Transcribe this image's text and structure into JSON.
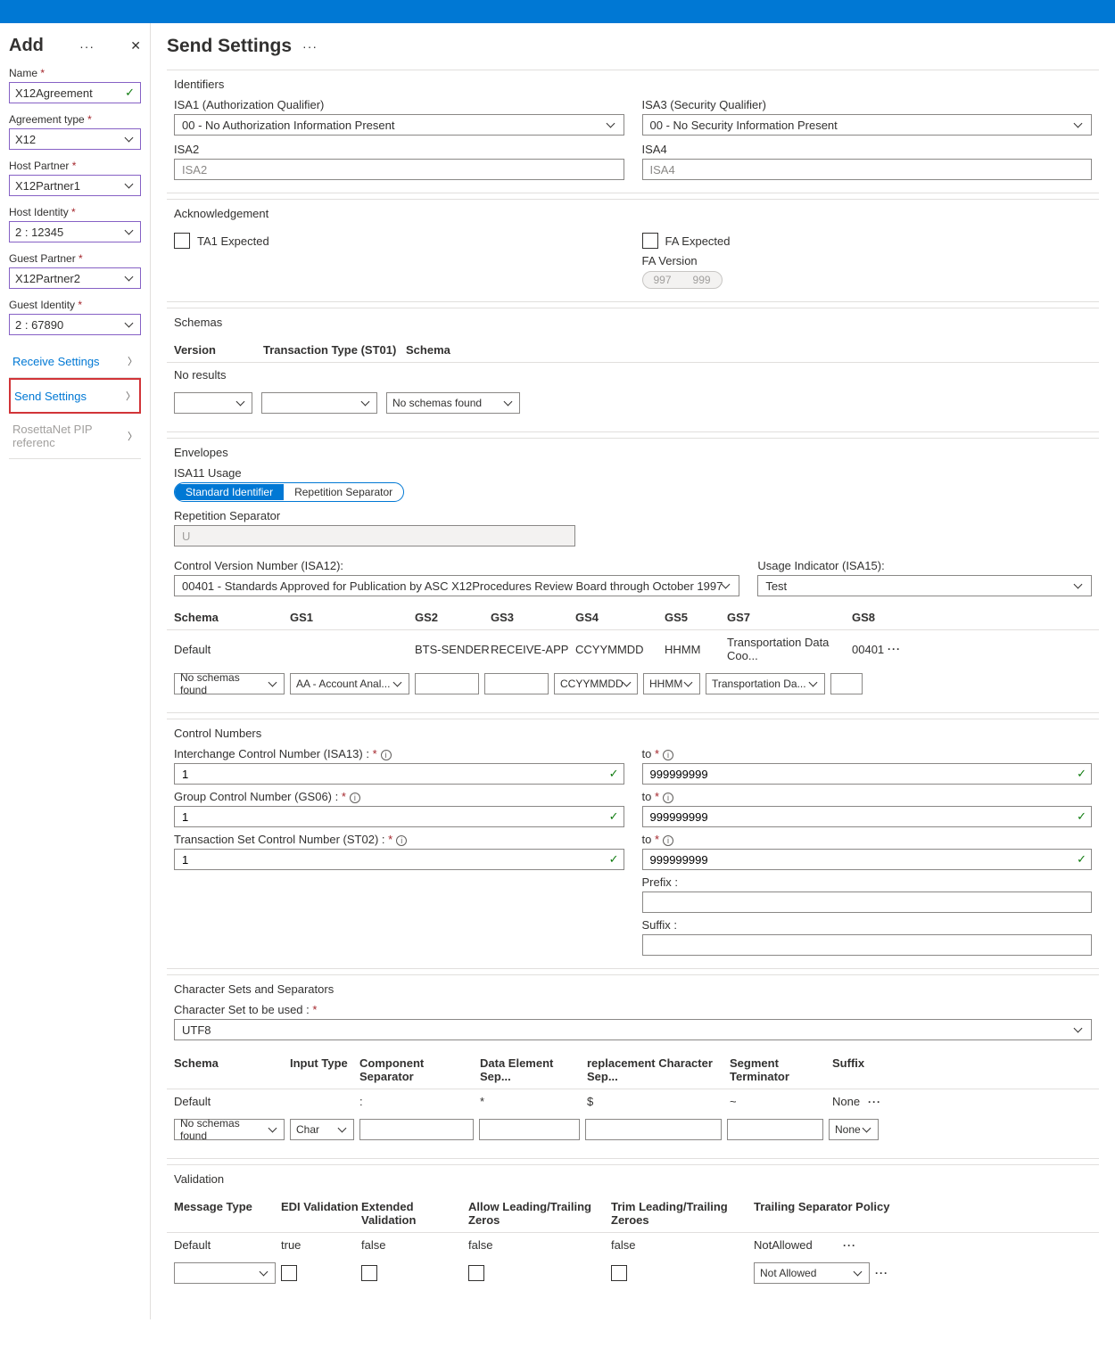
{
  "sidebar": {
    "title": "Add",
    "fields": {
      "name": {
        "label": "Name",
        "value": "X12Agreement"
      },
      "agreementType": {
        "label": "Agreement type",
        "value": "X12"
      },
      "hostPartner": {
        "label": "Host Partner",
        "value": "X12Partner1"
      },
      "hostIdentity": {
        "label": "Host Identity",
        "value": "2 : 12345"
      },
      "guestPartner": {
        "label": "Guest Partner",
        "value": "X12Partner2"
      },
      "guestIdentity": {
        "label": "Guest Identity",
        "value": "2 : 67890"
      }
    },
    "nav": {
      "receive": "Receive Settings",
      "send": "Send Settings",
      "rosetta": "RosettaNet PIP referenc"
    }
  },
  "main": {
    "title": "Send Settings",
    "identifiers": {
      "head": "Identifiers",
      "isa1": {
        "label": "ISA1 (Authorization Qualifier)",
        "value": "00 - No Authorization Information Present"
      },
      "isa3": {
        "label": "ISA3 (Security Qualifier)",
        "value": "00 - No Security Information Present"
      },
      "isa2": {
        "label": "ISA2",
        "placeholder": "ISA2"
      },
      "isa4": {
        "label": "ISA4",
        "placeholder": "ISA4"
      }
    },
    "ack": {
      "head": "Acknowledgement",
      "ta1": "TA1 Expected",
      "fa": "FA Expected",
      "faVersion": "FA Version",
      "v997": "997",
      "v999": "999"
    },
    "schemas": {
      "head": "Schemas",
      "cols": {
        "version": "Version",
        "tt": "Transaction Type (ST01)",
        "schema": "Schema"
      },
      "noResults": "No results",
      "noSchemas": "No schemas found"
    },
    "envelopes": {
      "head": "Envelopes",
      "isa11": "ISA11 Usage",
      "stdId": "Standard Identifier",
      "repSep": "Repetition Separator",
      "repSepLabel": "Repetition Separator",
      "repSepVal": "U",
      "cvn": {
        "label": "Control Version Number (ISA12):",
        "value": "00401 - Standards Approved for Publication by ASC X12Procedures Review Board through October 1997"
      },
      "usage": {
        "label": "Usage Indicator (ISA15):",
        "value": "Test"
      },
      "cols": {
        "schema": "Schema",
        "gs1": "GS1",
        "gs2": "GS2",
        "gs3": "GS3",
        "gs4": "GS4",
        "gs5": "GS5",
        "gs7": "GS7",
        "gs8": "GS8"
      },
      "defaultRow": {
        "schema": "Default",
        "gs2": "BTS-SENDER",
        "gs3": "RECEIVE-APP",
        "gs4": "CCYYMMDD",
        "gs5": "HHMM",
        "gs7": "Transportation Data Coo...",
        "gs8": "00401"
      },
      "editRow": {
        "schema": "No schemas found",
        "gs1": "AA - Account Anal...",
        "gs4": "CCYYMMDD",
        "gs5": "HHMM",
        "gs7": "Transportation Da..."
      }
    },
    "ctrl": {
      "head": "Control Numbers",
      "icn": "Interchange Control Number (ISA13) :",
      "gcn": "Group Control Number (GS06) :",
      "tscn": "Transaction Set Control Number (ST02) :",
      "to": "to",
      "one": "1",
      "nines": "999999999",
      "prefix": "Prefix :",
      "suffix": "Suffix :"
    },
    "charset": {
      "head": "Character Sets and Separators",
      "csLabel": "Character Set to be used :",
      "csVal": "UTF8",
      "cols": {
        "schema": "Schema",
        "inputType": "Input Type",
        "compSep": "Component Separator",
        "dataEl": "Data Element Sep...",
        "repl": "replacement Character Sep...",
        "segTerm": "Segment Terminator",
        "suffix": "Suffix"
      },
      "defaultRow": {
        "schema": "Default",
        "comp": ":",
        "data": "*",
        "repl": "$",
        "seg": "~",
        "suffix": "None"
      },
      "editRow": {
        "schema": "No schemas found",
        "inputType": "Char",
        "suffix": "None"
      }
    },
    "validation": {
      "head": "Validation",
      "cols": {
        "mt": "Message Type",
        "edi": "EDI Validation",
        "ext": "Extended Validation",
        "allow": "Allow Leading/Trailing Zeros",
        "trim": "Trim Leading/Trailing Zeroes",
        "trail": "Trailing Separator Policy"
      },
      "defaultRow": {
        "mt": "Default",
        "edi": "true",
        "ext": "false",
        "allow": "false",
        "trim": "false",
        "trail": "NotAllowed"
      },
      "editRow": {
        "trail": "Not Allowed"
      }
    }
  }
}
